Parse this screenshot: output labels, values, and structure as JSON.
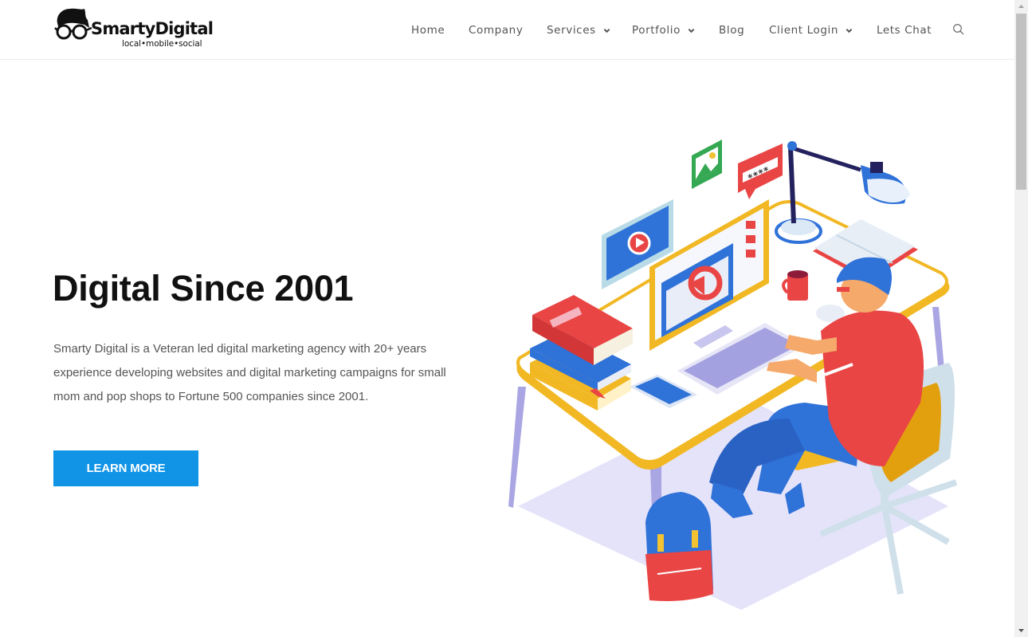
{
  "brand": {
    "name": "SmartyDigital",
    "tagline": "local•mobile•social"
  },
  "nav": {
    "items": [
      {
        "label": "Home",
        "has_dropdown": false
      },
      {
        "label": "Company",
        "has_dropdown": false
      },
      {
        "label": "Services",
        "has_dropdown": true
      },
      {
        "label": "Portfolio",
        "has_dropdown": true
      },
      {
        "label": "Blog",
        "has_dropdown": false
      },
      {
        "label": "Client Login",
        "has_dropdown": true
      },
      {
        "label": "Lets Chat",
        "has_dropdown": false
      }
    ],
    "search_icon": "search-icon"
  },
  "hero": {
    "title": "Digital Since 2001",
    "description": "Smarty Digital is a Veteran led digital marketing agency with 20+ years experience developing websites and digital marketing campaigns for small mom and pop shops to Fortune 500 companies since 2001.",
    "cta_label": "LEARN MORE",
    "illustration": "isometric-developer-at-desk-illustration",
    "password_bubble_text": "****"
  },
  "colors": {
    "accent": "#1193e6",
    "heading": "#111111",
    "body_text": "#555555",
    "nav_text": "#555555"
  }
}
